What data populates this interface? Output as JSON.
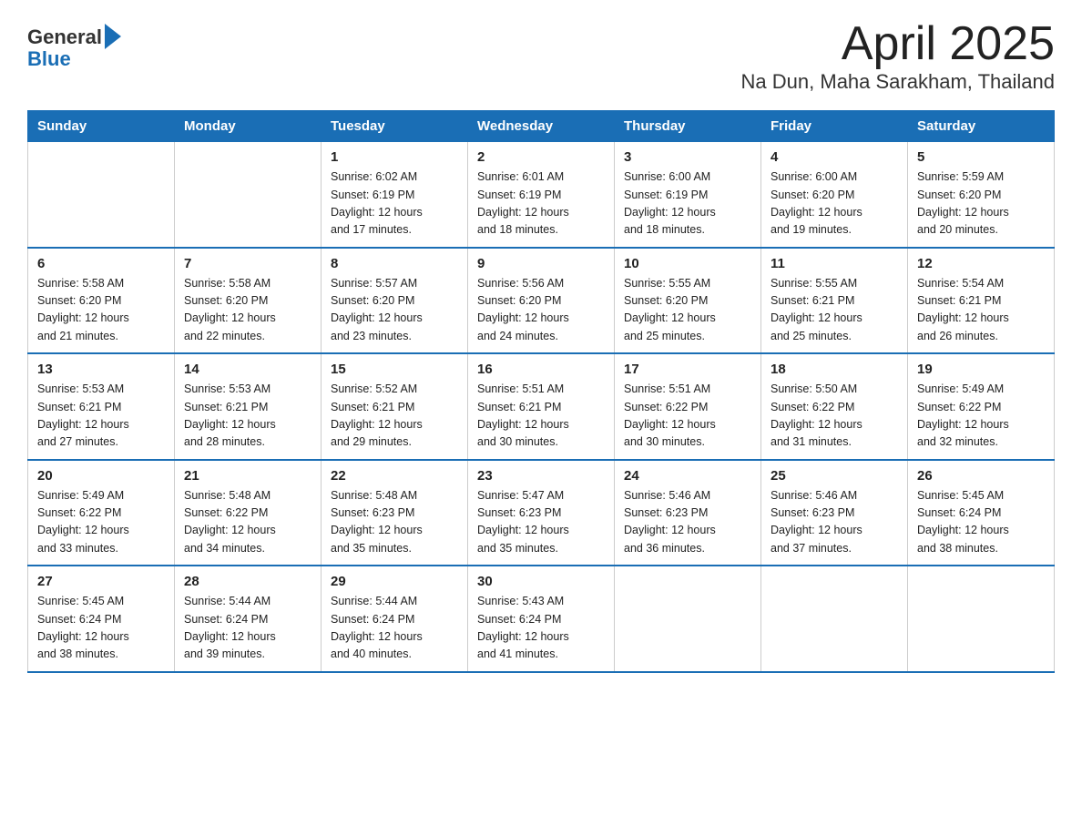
{
  "logo": {
    "general": "General",
    "blue": "Blue"
  },
  "title": "April 2025",
  "subtitle": "Na Dun, Maha Sarakham, Thailand",
  "header_days": [
    "Sunday",
    "Monday",
    "Tuesday",
    "Wednesday",
    "Thursday",
    "Friday",
    "Saturday"
  ],
  "weeks": [
    [
      {
        "day": "",
        "info": ""
      },
      {
        "day": "",
        "info": ""
      },
      {
        "day": "1",
        "info": "Sunrise: 6:02 AM\nSunset: 6:19 PM\nDaylight: 12 hours\nand 17 minutes."
      },
      {
        "day": "2",
        "info": "Sunrise: 6:01 AM\nSunset: 6:19 PM\nDaylight: 12 hours\nand 18 minutes."
      },
      {
        "day": "3",
        "info": "Sunrise: 6:00 AM\nSunset: 6:19 PM\nDaylight: 12 hours\nand 18 minutes."
      },
      {
        "day": "4",
        "info": "Sunrise: 6:00 AM\nSunset: 6:20 PM\nDaylight: 12 hours\nand 19 minutes."
      },
      {
        "day": "5",
        "info": "Sunrise: 5:59 AM\nSunset: 6:20 PM\nDaylight: 12 hours\nand 20 minutes."
      }
    ],
    [
      {
        "day": "6",
        "info": "Sunrise: 5:58 AM\nSunset: 6:20 PM\nDaylight: 12 hours\nand 21 minutes."
      },
      {
        "day": "7",
        "info": "Sunrise: 5:58 AM\nSunset: 6:20 PM\nDaylight: 12 hours\nand 22 minutes."
      },
      {
        "day": "8",
        "info": "Sunrise: 5:57 AM\nSunset: 6:20 PM\nDaylight: 12 hours\nand 23 minutes."
      },
      {
        "day": "9",
        "info": "Sunrise: 5:56 AM\nSunset: 6:20 PM\nDaylight: 12 hours\nand 24 minutes."
      },
      {
        "day": "10",
        "info": "Sunrise: 5:55 AM\nSunset: 6:20 PM\nDaylight: 12 hours\nand 25 minutes."
      },
      {
        "day": "11",
        "info": "Sunrise: 5:55 AM\nSunset: 6:21 PM\nDaylight: 12 hours\nand 25 minutes."
      },
      {
        "day": "12",
        "info": "Sunrise: 5:54 AM\nSunset: 6:21 PM\nDaylight: 12 hours\nand 26 minutes."
      }
    ],
    [
      {
        "day": "13",
        "info": "Sunrise: 5:53 AM\nSunset: 6:21 PM\nDaylight: 12 hours\nand 27 minutes."
      },
      {
        "day": "14",
        "info": "Sunrise: 5:53 AM\nSunset: 6:21 PM\nDaylight: 12 hours\nand 28 minutes."
      },
      {
        "day": "15",
        "info": "Sunrise: 5:52 AM\nSunset: 6:21 PM\nDaylight: 12 hours\nand 29 minutes."
      },
      {
        "day": "16",
        "info": "Sunrise: 5:51 AM\nSunset: 6:21 PM\nDaylight: 12 hours\nand 30 minutes."
      },
      {
        "day": "17",
        "info": "Sunrise: 5:51 AM\nSunset: 6:22 PM\nDaylight: 12 hours\nand 30 minutes."
      },
      {
        "day": "18",
        "info": "Sunrise: 5:50 AM\nSunset: 6:22 PM\nDaylight: 12 hours\nand 31 minutes."
      },
      {
        "day": "19",
        "info": "Sunrise: 5:49 AM\nSunset: 6:22 PM\nDaylight: 12 hours\nand 32 minutes."
      }
    ],
    [
      {
        "day": "20",
        "info": "Sunrise: 5:49 AM\nSunset: 6:22 PM\nDaylight: 12 hours\nand 33 minutes."
      },
      {
        "day": "21",
        "info": "Sunrise: 5:48 AM\nSunset: 6:22 PM\nDaylight: 12 hours\nand 34 minutes."
      },
      {
        "day": "22",
        "info": "Sunrise: 5:48 AM\nSunset: 6:23 PM\nDaylight: 12 hours\nand 35 minutes."
      },
      {
        "day": "23",
        "info": "Sunrise: 5:47 AM\nSunset: 6:23 PM\nDaylight: 12 hours\nand 35 minutes."
      },
      {
        "day": "24",
        "info": "Sunrise: 5:46 AM\nSunset: 6:23 PM\nDaylight: 12 hours\nand 36 minutes."
      },
      {
        "day": "25",
        "info": "Sunrise: 5:46 AM\nSunset: 6:23 PM\nDaylight: 12 hours\nand 37 minutes."
      },
      {
        "day": "26",
        "info": "Sunrise: 5:45 AM\nSunset: 6:24 PM\nDaylight: 12 hours\nand 38 minutes."
      }
    ],
    [
      {
        "day": "27",
        "info": "Sunrise: 5:45 AM\nSunset: 6:24 PM\nDaylight: 12 hours\nand 38 minutes."
      },
      {
        "day": "28",
        "info": "Sunrise: 5:44 AM\nSunset: 6:24 PM\nDaylight: 12 hours\nand 39 minutes."
      },
      {
        "day": "29",
        "info": "Sunrise: 5:44 AM\nSunset: 6:24 PM\nDaylight: 12 hours\nand 40 minutes."
      },
      {
        "day": "30",
        "info": "Sunrise: 5:43 AM\nSunset: 6:24 PM\nDaylight: 12 hours\nand 41 minutes."
      },
      {
        "day": "",
        "info": ""
      },
      {
        "day": "",
        "info": ""
      },
      {
        "day": "",
        "info": ""
      }
    ]
  ]
}
